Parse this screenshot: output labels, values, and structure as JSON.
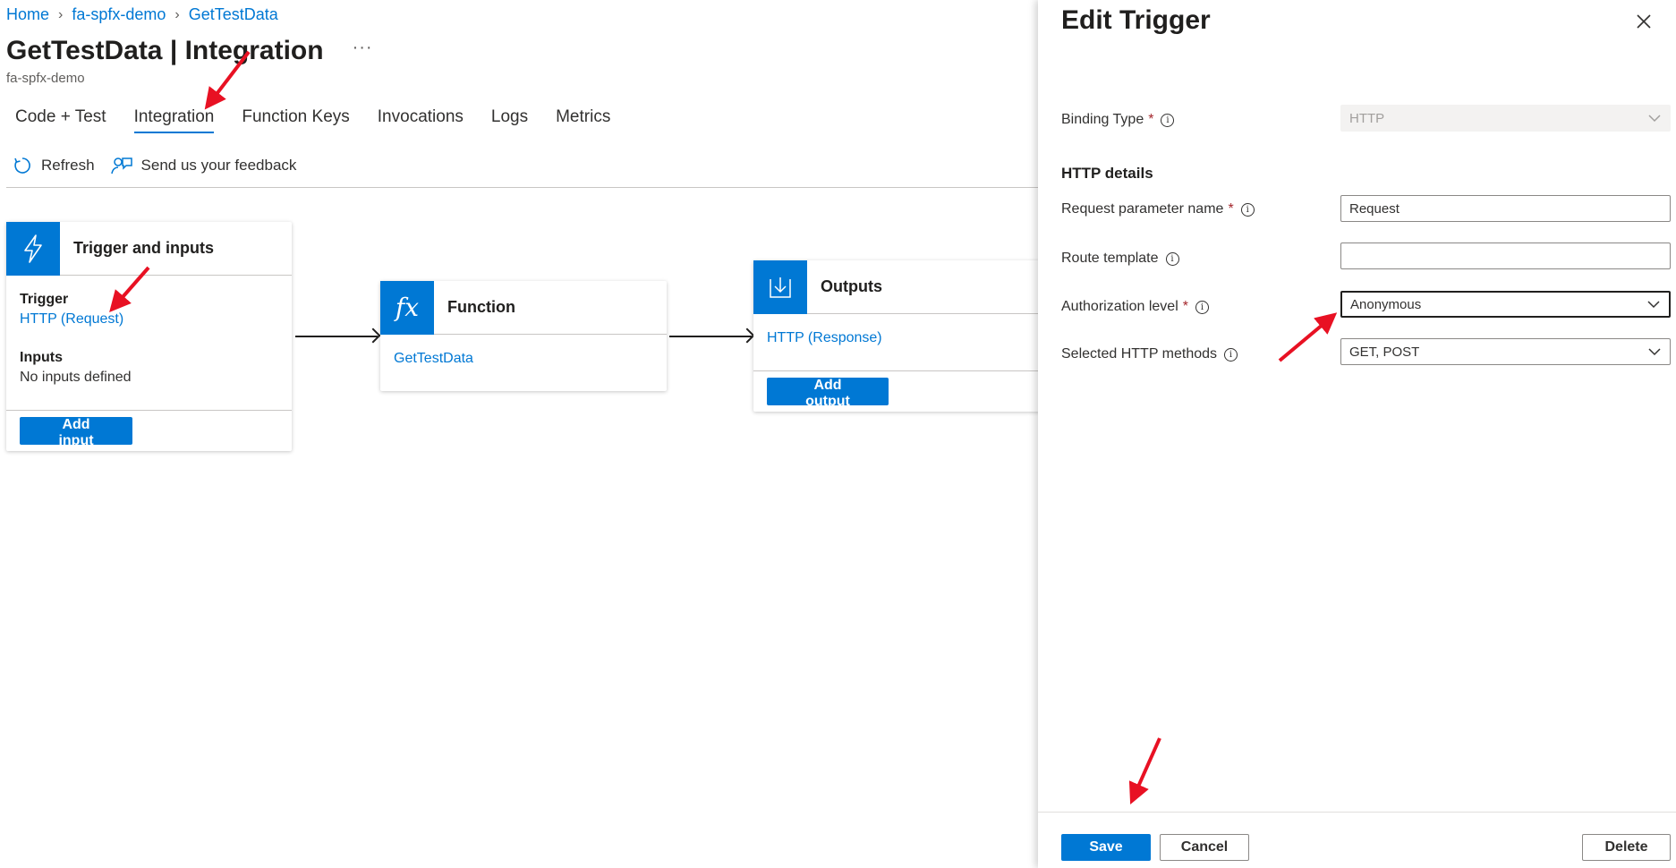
{
  "breadcrumb": {
    "items": [
      "Home",
      "fa-spfx-demo",
      "GetTestData"
    ]
  },
  "header": {
    "title_bold": "GetTestData",
    "title_rest": " | Integration",
    "more": "···",
    "subtitle": "fa-spfx-demo"
  },
  "tabs": [
    {
      "label": "Code + Test"
    },
    {
      "label": "Integration",
      "active": true
    },
    {
      "label": "Function Keys"
    },
    {
      "label": "Invocations"
    },
    {
      "label": "Logs"
    },
    {
      "label": "Metrics"
    }
  ],
  "toolbar": {
    "refresh": "Refresh",
    "feedback": "Send us your feedback"
  },
  "trigger_card": {
    "title": "Trigger and inputs",
    "trigger_label": "Trigger",
    "trigger_link": "HTTP (Request)",
    "inputs_label": "Inputs",
    "inputs_text": "No inputs defined",
    "add_button": "Add input"
  },
  "function_card": {
    "title": "Function",
    "icon_text": "fx",
    "link": "GetTestData"
  },
  "outputs_card": {
    "title": "Outputs",
    "link": "HTTP (Response)",
    "add_button": "Add output"
  },
  "panel": {
    "title": "Edit Trigger",
    "binding_type_label": "Binding Type",
    "binding_type_value": "HTTP",
    "section": "HTTP details",
    "request_param_label": "Request parameter name",
    "request_param_value": "Request",
    "route_label": "Route template",
    "route_value": "",
    "auth_label": "Authorization level",
    "auth_value": "Anonymous",
    "methods_label": "Selected HTTP methods",
    "methods_value": "GET, POST",
    "save": "Save",
    "cancel": "Cancel",
    "delete": "Delete"
  },
  "colors": {
    "accent": "#0078d4",
    "annotation_arrow": "#e81123",
    "required": "#a4262c"
  },
  "icons": [
    "chevron-right-icon",
    "ellipsis-icon",
    "refresh-icon",
    "feedback-icon",
    "lightning-icon",
    "download-icon",
    "chevron-down-icon",
    "close-icon",
    "info-icon"
  ]
}
